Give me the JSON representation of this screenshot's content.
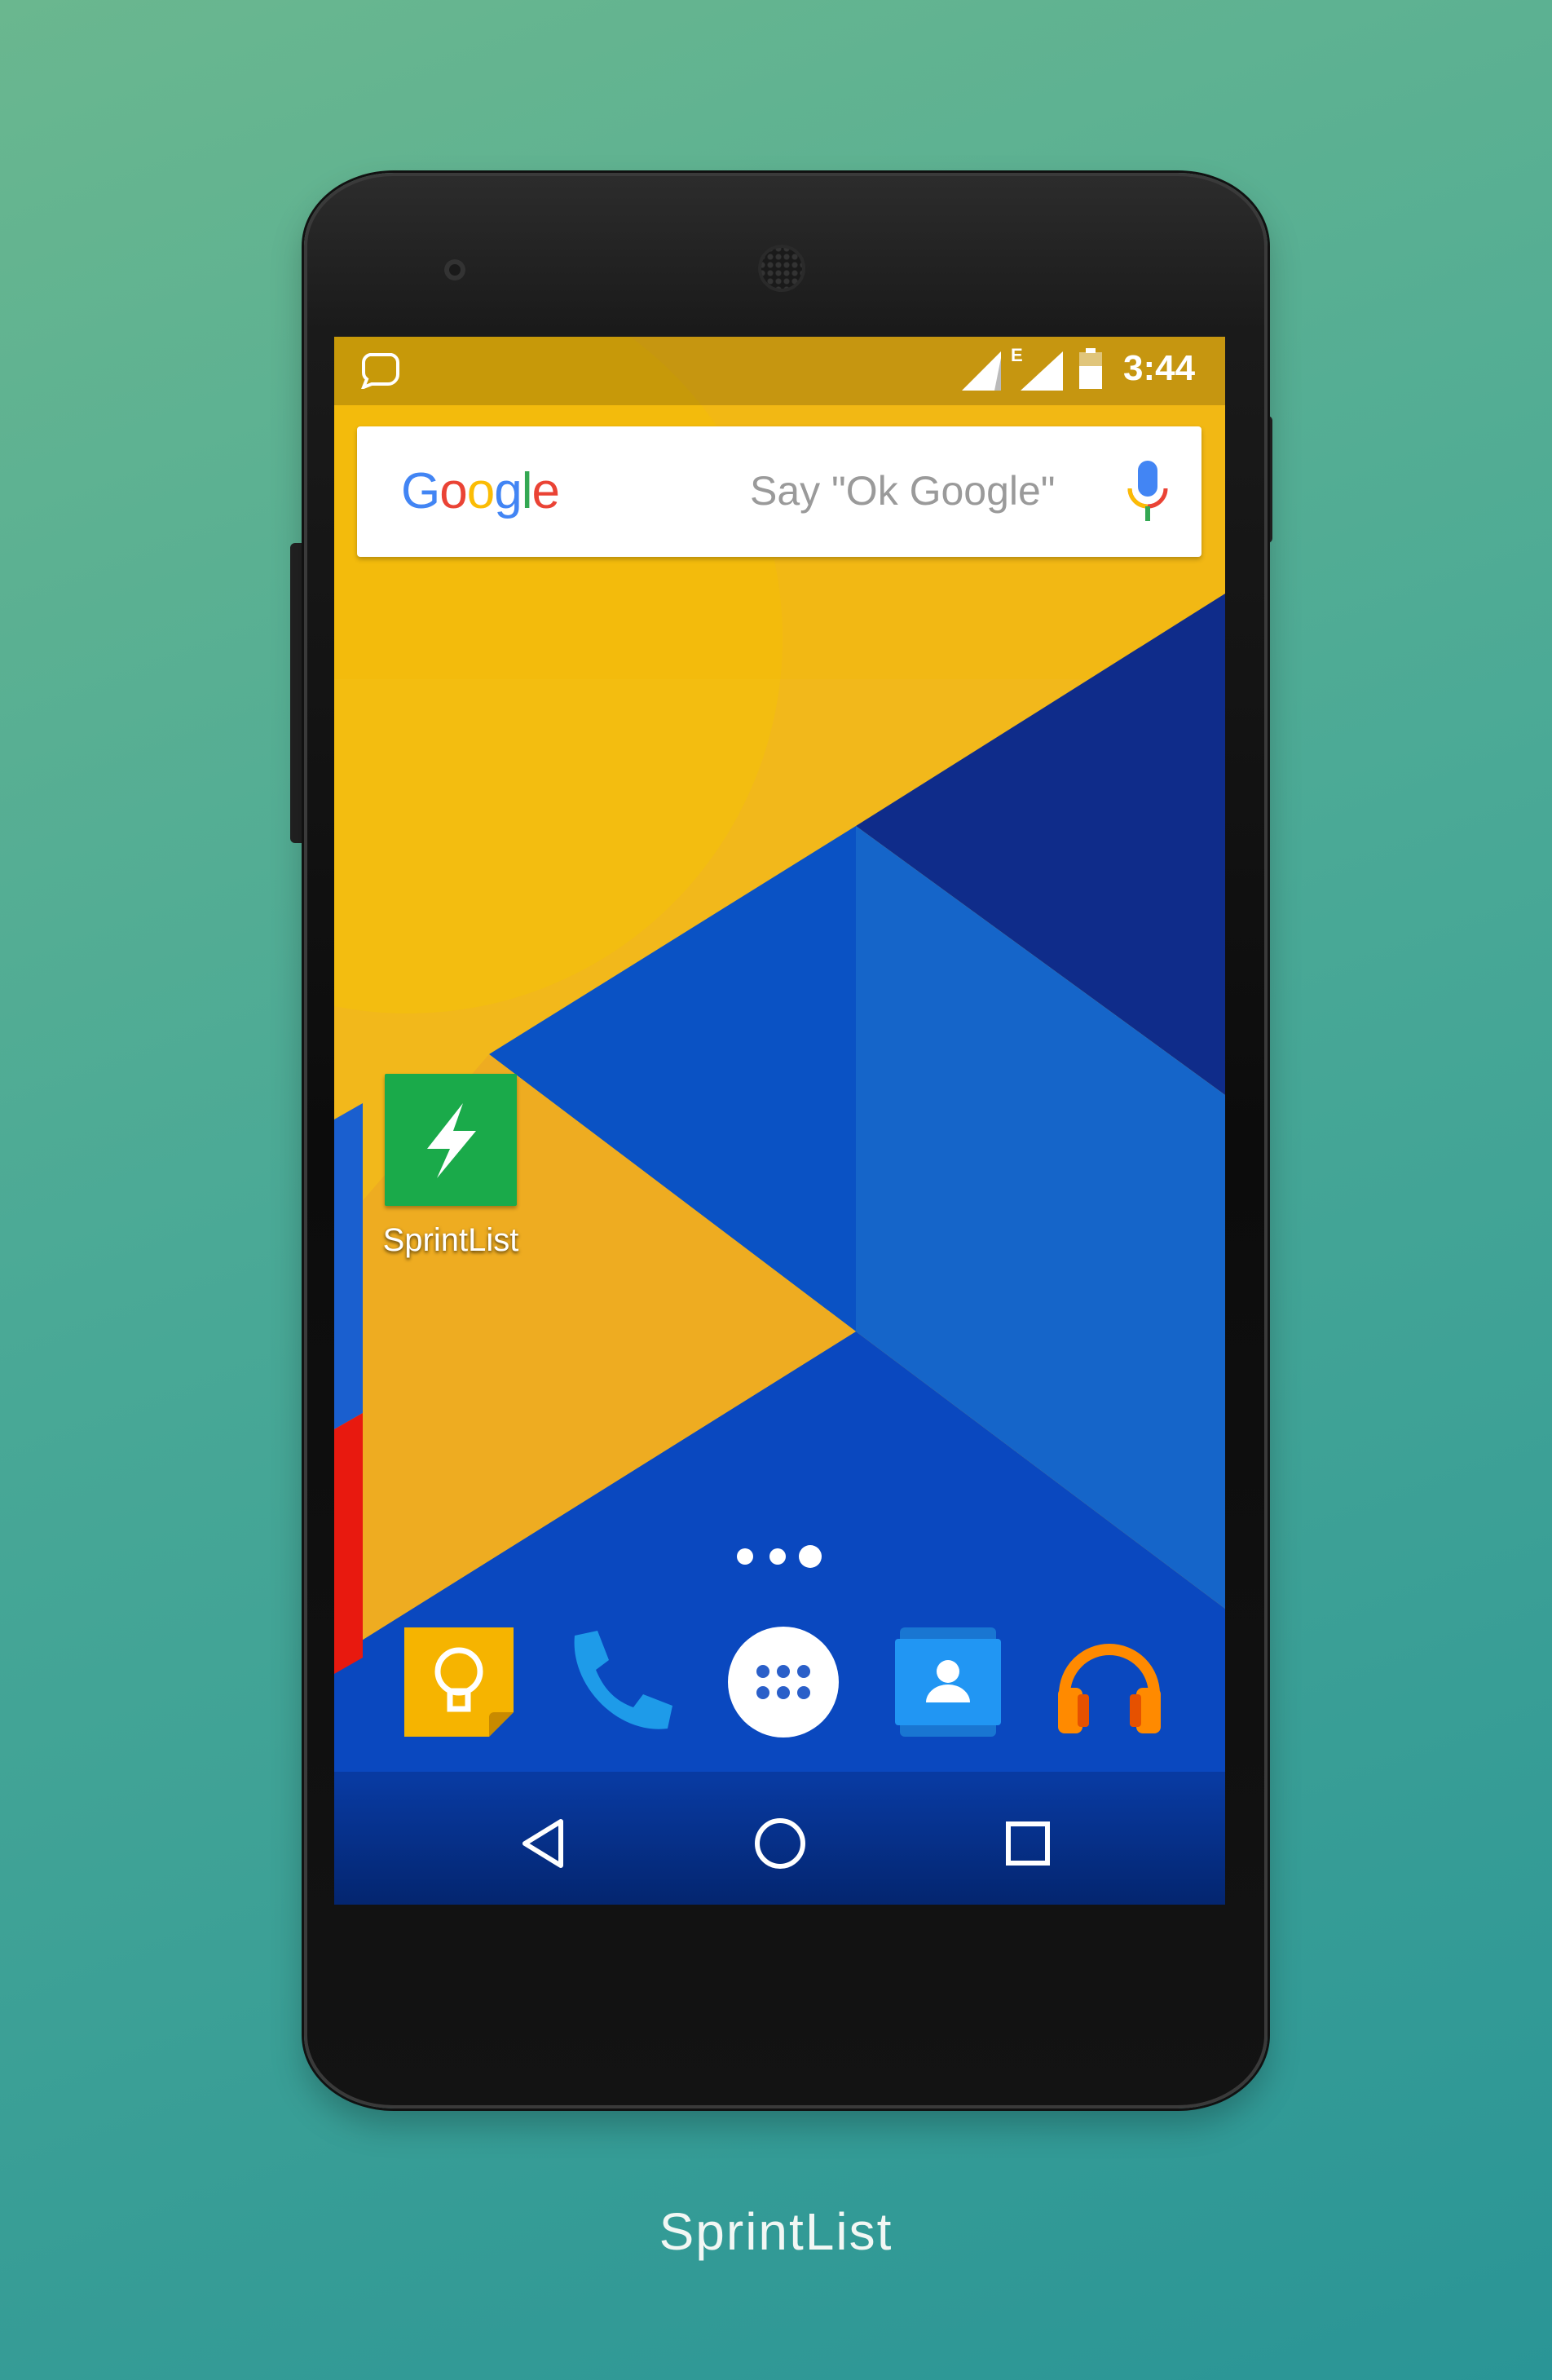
{
  "status_bar": {
    "clock": "3:44",
    "network_type": "E",
    "icons": [
      "notification-bubble-icon",
      "signal-icon",
      "signal-e-icon",
      "battery-icon"
    ]
  },
  "search_widget": {
    "logo": "Google",
    "hint": "Say \"Ok Google\"",
    "mic_icon": "mic-icon"
  },
  "home": {
    "apps": [
      {
        "label": "SprintList",
        "icon": "lightning-bolt-icon",
        "color": "#1aaa4a"
      }
    ],
    "page_count": 3,
    "current_page": 3
  },
  "dock": [
    {
      "name": "keep",
      "icon": "lightbulb-icon",
      "color": "#f6b400"
    },
    {
      "name": "phone",
      "icon": "phone-icon",
      "color": "#1e9be9"
    },
    {
      "name": "app-drawer",
      "icon": "app-drawer-icon",
      "color": "#ffffff"
    },
    {
      "name": "contacts",
      "icon": "contacts-icon",
      "color": "#2196f3"
    },
    {
      "name": "play-music",
      "icon": "headphones-icon",
      "color": "#ff8a00"
    }
  ],
  "nav_bar": [
    "back-icon",
    "home-icon",
    "recents-icon"
  ],
  "caption": "SprintList"
}
